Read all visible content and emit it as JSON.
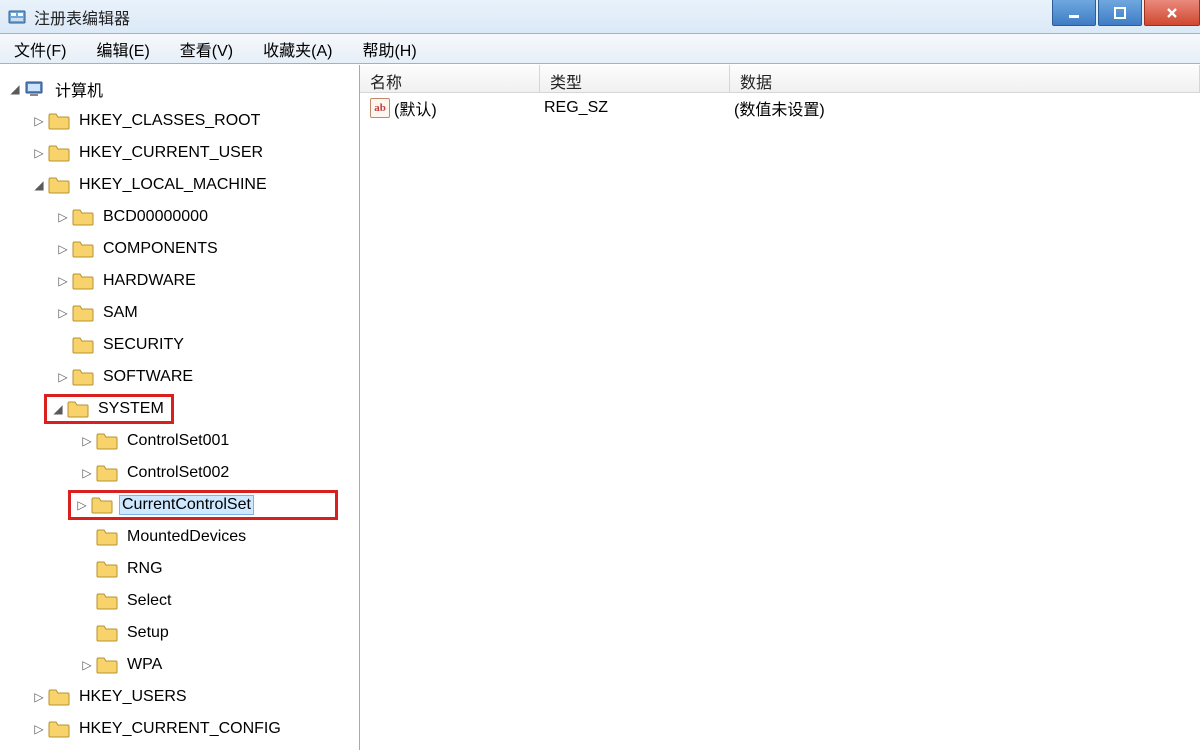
{
  "window": {
    "title": "注册表编辑器"
  },
  "menu": {
    "file": "文件(F)",
    "edit": "编辑(E)",
    "view": "查看(V)",
    "favorites": "收藏夹(A)",
    "help": "帮助(H)"
  },
  "tree": {
    "root": "计算机",
    "hkcr": "HKEY_CLASSES_ROOT",
    "hkcu": "HKEY_CURRENT_USER",
    "hklm": "HKEY_LOCAL_MACHINE",
    "hklm_children": {
      "bcd": "BCD00000000",
      "components": "COMPONENTS",
      "hardware": "HARDWARE",
      "sam": "SAM",
      "security": "SECURITY",
      "software": "SOFTWARE",
      "system": "SYSTEM",
      "system_children": {
        "cs001": "ControlSet001",
        "cs002": "ControlSet002",
        "ccs": "CurrentControlSet",
        "mounted": "MountedDevices",
        "rng": "RNG",
        "select": "Select",
        "setup": "Setup",
        "wpa": "WPA"
      }
    },
    "hku": "HKEY_USERS",
    "hkcc": "HKEY_CURRENT_CONFIG"
  },
  "list": {
    "col_name": "名称",
    "col_type": "类型",
    "col_data": "数据",
    "rows": [
      {
        "name": "(默认)",
        "type": "REG_SZ",
        "data": "(数值未设置)"
      }
    ]
  },
  "value_icon_text": "ab"
}
